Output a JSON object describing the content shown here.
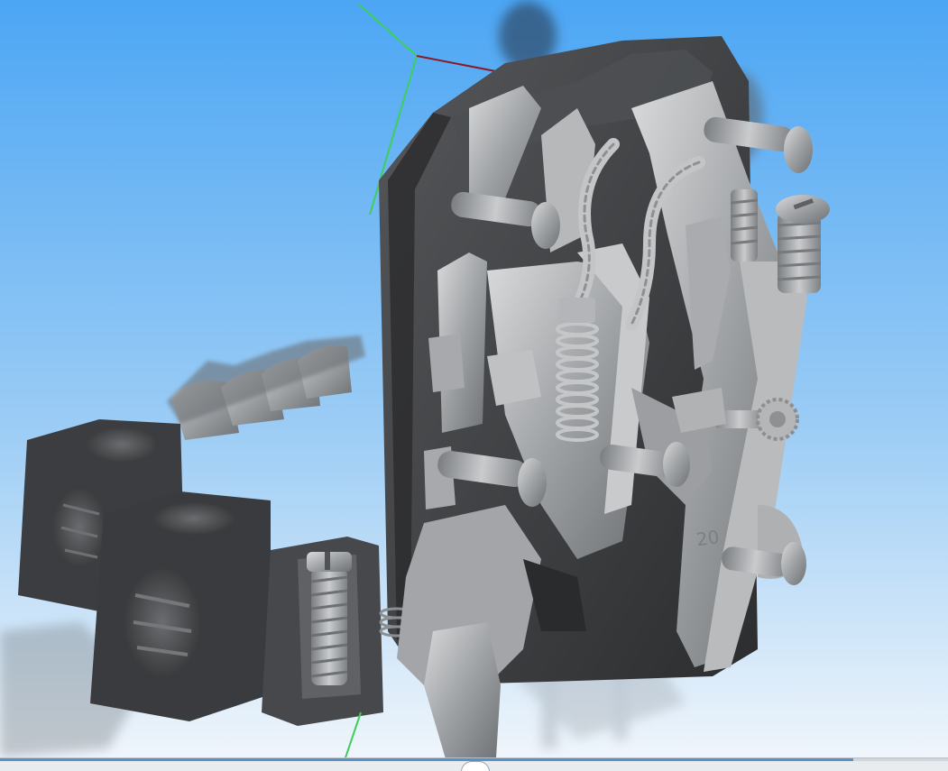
{
  "viewer": {
    "background_top": "#4da8f5",
    "background_bottom": "#eef5fb",
    "axis_color_green": "#3ccf5a",
    "axis_color_red": "#8a1a2a",
    "model_color": "#8f9295",
    "model_dark": "#3a3b3d",
    "part_marking": "20"
  },
  "timeline": {
    "progress": 0.9,
    "handle_icon": "circle-handle-icon"
  }
}
